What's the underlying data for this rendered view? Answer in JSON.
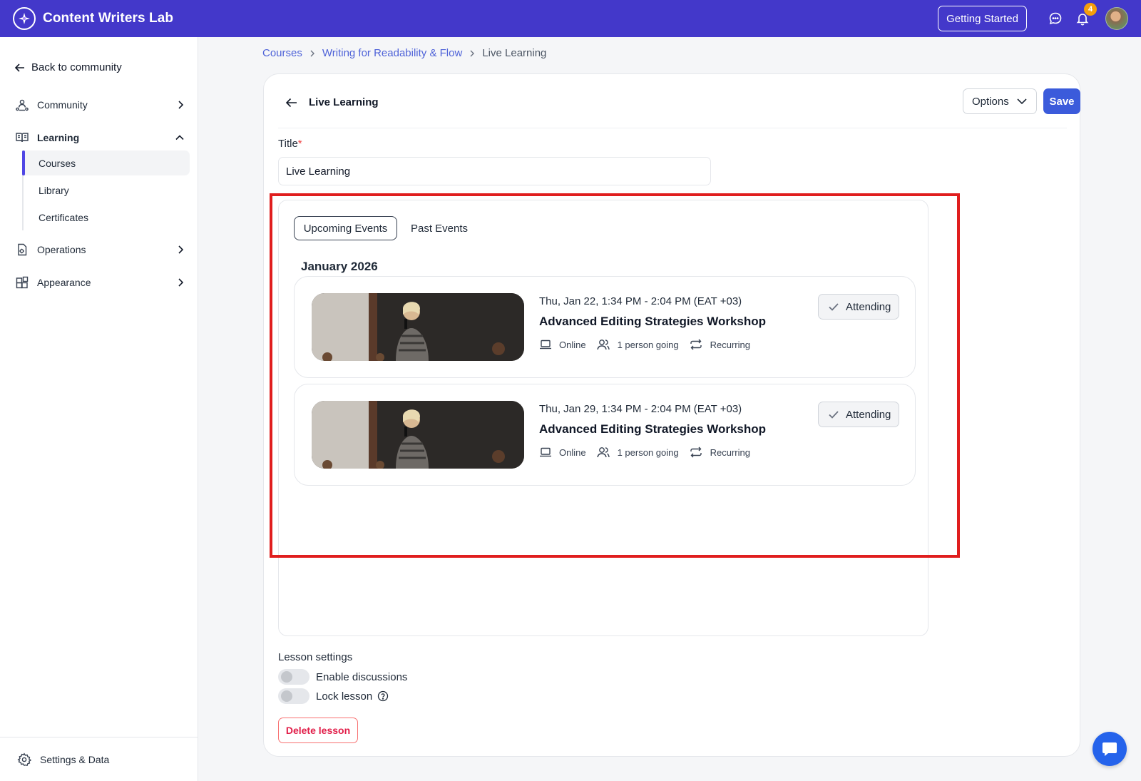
{
  "app": {
    "name": "Content Writers Lab"
  },
  "topbar": {
    "getting_started": "Getting Started",
    "notification_count": "4"
  },
  "sidebar": {
    "back_link": "Back to community",
    "items": [
      {
        "label": "Community",
        "icon": "community-icon"
      },
      {
        "label": "Learning",
        "icon": "book-icon"
      },
      {
        "label": "Operations",
        "icon": "operations-icon"
      },
      {
        "label": "Appearance",
        "icon": "appearance-icon"
      }
    ],
    "subitems": [
      {
        "label": "Courses",
        "active": true
      },
      {
        "label": "Library",
        "active": false
      },
      {
        "label": "Certificates",
        "active": false
      }
    ],
    "footer": "Settings & Data"
  },
  "breadcrumb": [
    "Courses",
    "Writing for Readability & Flow",
    "Live Learning"
  ],
  "lesson": {
    "header_title": "Live Learning",
    "options_label": "Options",
    "save_label": "Save",
    "title_label": "Title",
    "title_required_mark": "*",
    "title_value": "Live Learning"
  },
  "events": {
    "tabs": [
      "Upcoming Events",
      "Past Events"
    ],
    "month": "January 2026",
    "items": [
      {
        "date": "Thu, Jan 22, 1:34 PM - 2:04 PM (EAT +03)",
        "title": "Advanced Editing Strategies Workshop",
        "location": "Online",
        "going": "1 person going",
        "recurrence": "Recurring",
        "status": "Attending"
      },
      {
        "date": "Thu, Jan 29, 1:34 PM - 2:04 PM (EAT +03)",
        "title": "Advanced Editing Strategies Workshop",
        "location": "Online",
        "going": "1 person going",
        "recurrence": "Recurring",
        "status": "Attending"
      }
    ]
  },
  "lesson_settings": {
    "label": "Lesson settings",
    "enable_discussions": "Enable discussions",
    "lock_lesson": "Lock lesson",
    "delete_label": "Delete lesson"
  },
  "colors": {
    "topbar": "#4338ca",
    "primary_button": "#3b5bdb",
    "link": "#4f63d8",
    "danger": "#e11d48",
    "highlight": "#e01e1e"
  }
}
